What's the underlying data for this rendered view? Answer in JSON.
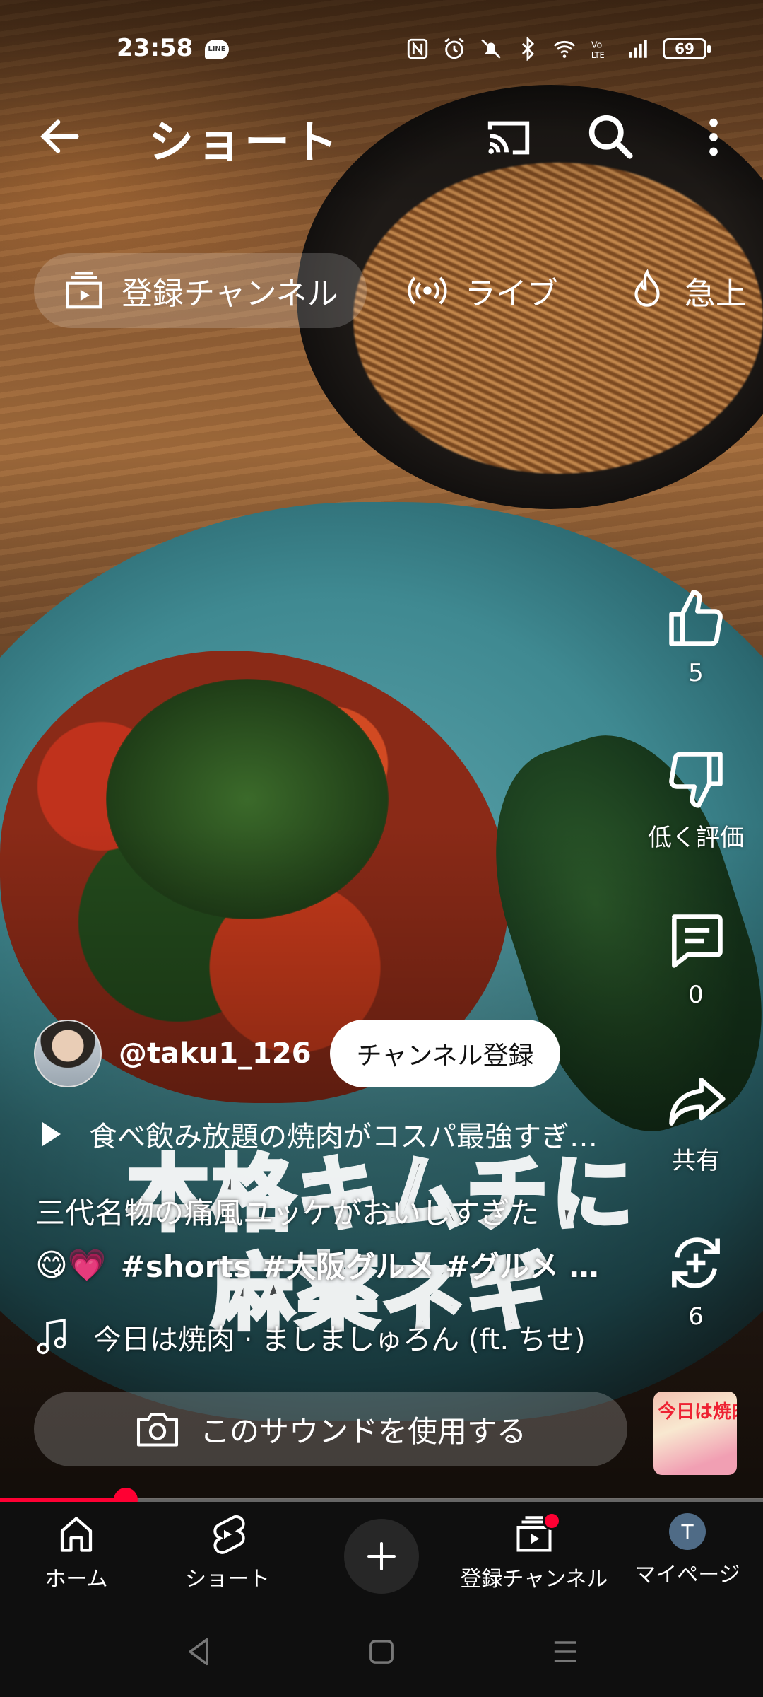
{
  "status_bar": {
    "time": "23:58",
    "line_badge": "LINE",
    "battery": "69"
  },
  "app_bar": {
    "title": "ショート",
    "icons": [
      "back-arrow-icon",
      "cast-icon",
      "search-icon",
      "more-vert-icon"
    ]
  },
  "chips": [
    {
      "label": "登録チャンネル",
      "icon": "subscriptions-icon"
    },
    {
      "label": "ライブ",
      "icon": "live-icon"
    },
    {
      "label": "急上",
      "icon": "trending-icon"
    }
  ],
  "overlay_caption": {
    "line1": "本格キムチに",
    "line2": "麻薬ネギ"
  },
  "actions": {
    "like": {
      "label": "5",
      "icon": "thumb-up-icon"
    },
    "dislike": {
      "label": "低く評価",
      "icon": "thumb-down-icon"
    },
    "comments": {
      "label": "0",
      "icon": "comment-icon"
    },
    "share": {
      "label": "共有",
      "icon": "share-icon"
    },
    "remix": {
      "label": "6",
      "icon": "remix-icon"
    }
  },
  "channel": {
    "handle": "@taku1_126",
    "subscribe_label": "チャンネル登録"
  },
  "playlist_title": "食べ飲み放題の焼肉がコスパ最強すぎ…",
  "description": {
    "line1": "三代名物の痛風ユッケがおいしすぎた",
    "emojis": "😋💗",
    "hashtags": "#shorts #大阪グルメ #グルメ  …"
  },
  "sound": {
    "title": "今日は焼肉 · ましましゅろん (ft. ちせ)",
    "use_sound_label": "このサウンドを使用する",
    "thumb_text": "今日は焼肉"
  },
  "progress": {
    "fraction": 0.165
  },
  "bottom_nav": {
    "home": "ホーム",
    "shorts": "ショート",
    "subscriptions": "登録チャンネル",
    "me": "マイページ",
    "me_initial": "T"
  },
  "colors": {
    "accent": "#ff0033",
    "nav_bg": "#0f0f0f",
    "chip_bg": "rgba(255,255,255,0.18)"
  }
}
